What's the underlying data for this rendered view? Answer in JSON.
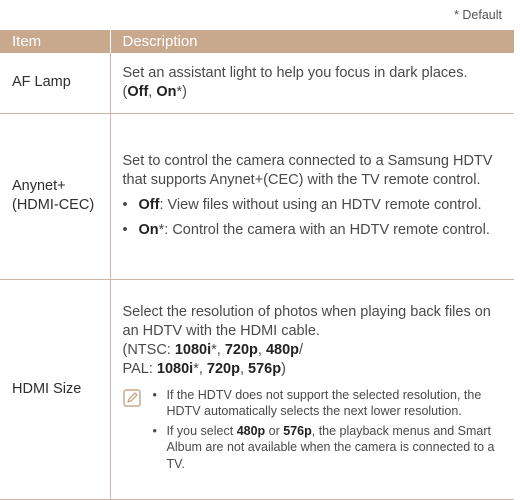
{
  "default_note": "* Default",
  "header": {
    "item": "Item",
    "description": "Description"
  },
  "rows": [
    {
      "item": "AF Lamp",
      "desc_text": "Set an assistant light to help you focus in dark places.",
      "opt_open": "(",
      "opt_off": "Off",
      "opt_sep": ", ",
      "opt_on": "On",
      "opt_close": "*)"
    },
    {
      "item_line1": "Anynet+",
      "item_line2": "(HDMI-CEC)",
      "desc_text": "Set to control the camera connected to a Samsung HDTV that supports Anynet+(CEC) with the TV remote control.",
      "bullet1_label": "Off",
      "bullet1_text": ": View files without using an HDTV remote control.",
      "bullet2_label": "On",
      "bullet2_text": "*: Control the camera with an HDTV remote control."
    },
    {
      "item": "HDMI Size",
      "desc_text": "Select the resolution of photos when playing back files on an HDTV with the HDMI cable.",
      "ntsc_prefix": "(NTSC: ",
      "ntsc_1": "1080i",
      "ntsc_1_suffix": "*, ",
      "ntsc_2": "720p",
      "ntsc_sep": ", ",
      "ntsc_3": "480p",
      "ntsc_end": "/",
      "pal_prefix": "PAL: ",
      "pal_1": "1080i",
      "pal_1_suffix": "*, ",
      "pal_2": "720p",
      "pal_sep": ", ",
      "pal_3": "576p",
      "pal_end": ")",
      "note_icon": "note-pencil-icon",
      "note1": "If the HDTV does not support the selected resolution, the HDTV automatically selects the next lower resolution.",
      "note2_pre": "If you select ",
      "note2_b1": "480p",
      "note2_mid": " or ",
      "note2_b2": "576p",
      "note2_post": ", the playback menus and Smart Album are not available when the camera is connected to a TV."
    }
  ]
}
